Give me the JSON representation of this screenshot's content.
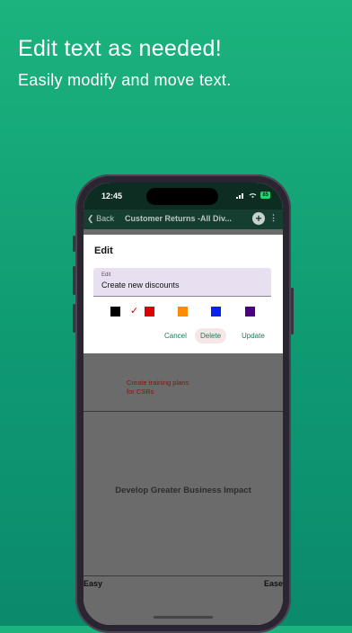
{
  "promo": {
    "headline": "Edit text as needed!",
    "subline": "Easily modify and move text."
  },
  "status_bar": {
    "time": "12:45",
    "battery": "85"
  },
  "nav": {
    "back_label": "Back",
    "title": "Customer Returns -All Div...",
    "add_icon": "plus-circle-icon",
    "more_icon": "kebab-menu-icon"
  },
  "dialog": {
    "title": "Edit",
    "field_label": "Edit",
    "field_value": "Create new discounts",
    "colors": [
      {
        "name": "black",
        "hex": "#000000"
      },
      {
        "name": "red",
        "hex": "#e00000",
        "selected": true
      },
      {
        "name": "orange",
        "hex": "#ff8c00"
      },
      {
        "name": "blue",
        "hex": "#0a22f0"
      },
      {
        "name": "purple",
        "hex": "#4b0082"
      }
    ],
    "cancel_label": "Cancel",
    "delete_label": "Delete",
    "update_label": "Update"
  },
  "board": {
    "note_line1": "Create training plans",
    "note_line2": "for CSRs",
    "goal_label": "Develop Greater Business Impact",
    "axis_left": "Easy",
    "axis_right": "Ease"
  },
  "accent_color": "#1cb37e"
}
